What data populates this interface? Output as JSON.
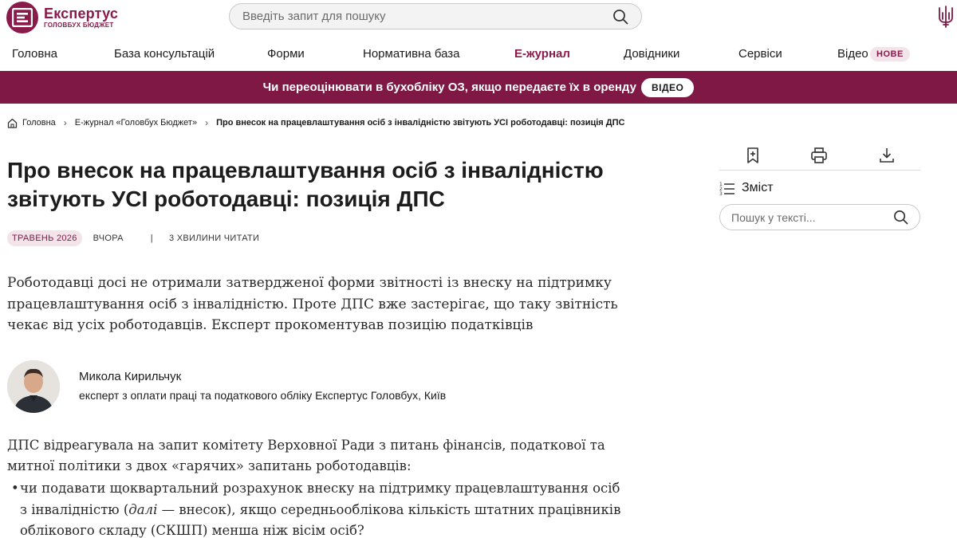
{
  "brand": {
    "name": "Експертус",
    "subtitle": "ГОЛОВБУХ БЮДЖЕТ",
    "color": "#8a1a4a"
  },
  "search": {
    "placeholder": "Введіть запит для пошуку"
  },
  "nav": {
    "items": [
      {
        "label": "Головна"
      },
      {
        "label": "База консультацій"
      },
      {
        "label": "Форми"
      },
      {
        "label": "Нормативна база"
      },
      {
        "label": "Е-журнал"
      },
      {
        "label": "Довідники"
      },
      {
        "label": "Сервіси"
      },
      {
        "label": "Відео"
      }
    ],
    "badge": "НОВЕ"
  },
  "banner": {
    "text": "Чи переоцінювати в бухобліку ОЗ, якщо передаєте їх в оренду",
    "button": "ВІДЕО",
    "color": "#7f1845"
  },
  "breadcrumb": {
    "home": "Головна",
    "section": "Е-журнал «Головбух Бюджет»",
    "current": "Про внесок на працевлаштування осіб з інвалідністю звітують УСІ роботодавці: позиція ДПС"
  },
  "article": {
    "title": "Про внесок на працевлаштування осіб з інвалідністю звітують УСІ роботодавці: позиція ДПС",
    "date_tag": "ТРАВЕНЬ 2026",
    "when": "ВЧОРА",
    "separator": "|",
    "read_time": "3 ХВИЛИНИ ЧИТАТИ",
    "lead": "Роботодавці досі не отримали затвердженої форми звітності із внеску на підтримку працевлаштування осіб з інвалідністю. Проте ДПС вже застерігає, що таку звітність чекає від усіх роботодавців. Експерт прокоментував позицію податківців",
    "author": {
      "name": "Микола Кирильчук",
      "role": "експерт з оплати праці та податкового обліку Експертус Головбух, Київ"
    },
    "paragraph": "ДПС відреагувала на запит комітету Верховної Ради з питань фінансів, податкової та митної політики з двох «гарячих» запитань роботодавців:",
    "bullet": {
      "marker": "•",
      "before": "чи подавати щоквартальний розрахунок внеску на підтримку працевлаштування осіб з інвалідністю (",
      "italic": "далі",
      "after": " — внесок), якщо середньооблікова кількість штатних працівників облікового складу (СКШП) менша ніж вісім осіб?"
    }
  },
  "sidebar": {
    "toc_label": "Зміст",
    "search_placeholder": "Пошук у тексті..."
  }
}
